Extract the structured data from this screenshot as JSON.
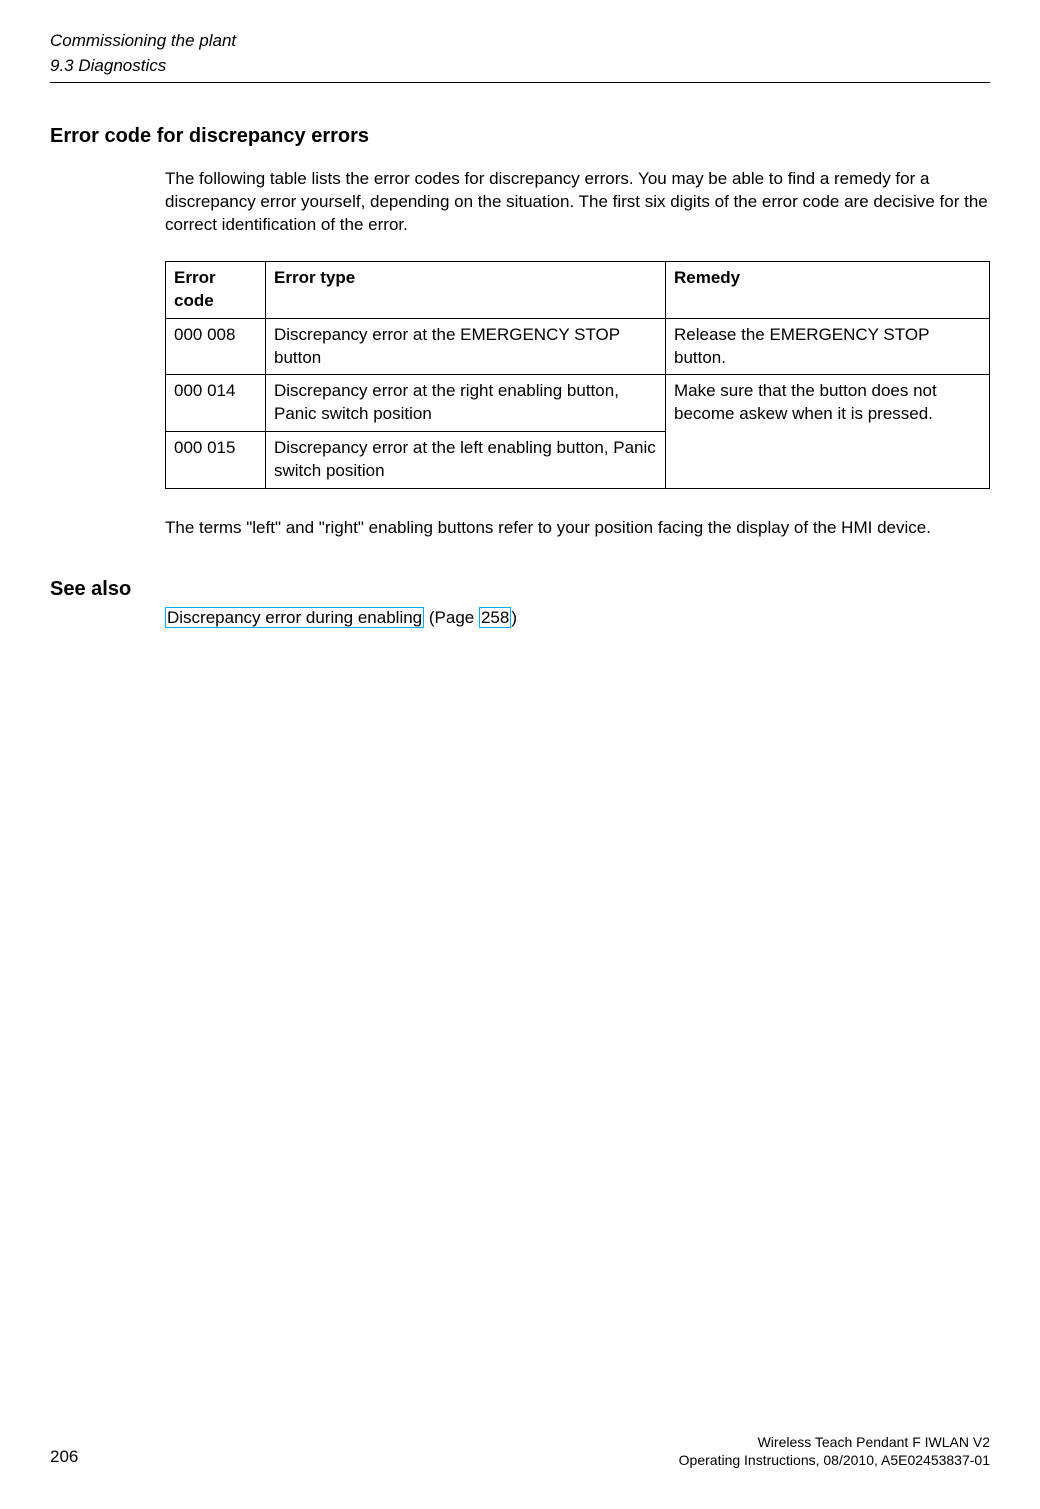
{
  "header": {
    "chapter": "Commissioning the plant",
    "section": "9.3 Diagnostics"
  },
  "heading1": "Error code for discrepancy errors",
  "intro": "The following table lists the error codes for discrepancy errors. You may be able to find a remedy for a discrepancy error yourself, depending on the situation. The first six digits of the error code are decisive for the correct identification of the error.",
  "table": {
    "head": {
      "code": "Error code",
      "type": "Error type",
      "remedy": "Remedy"
    },
    "rows": [
      {
        "code": "000 008",
        "type": "Discrepancy error at the EMERGENCY STOP button",
        "remedy": "Release the EMERGENCY STOP button."
      },
      {
        "code": "000 014",
        "type": "Discrepancy error at the right enabling button, Panic switch position",
        "remedy": "Make sure that the button does not become askew when it is pressed."
      },
      {
        "code": "000 015",
        "type": "Discrepancy error at the left enabling button, Panic switch position"
      }
    ]
  },
  "note": "The terms \"left\" and \"right\" enabling buttons refer to your position facing the display of the HMI device.",
  "seeAlso": {
    "heading": "See also",
    "linkText": "Discrepancy error during enabling",
    "pagePrefix": " (Page ",
    "pageNum": "258",
    "pageSuffix": ")"
  },
  "footer": {
    "line1": "Wireless Teach Pendant F IWLAN V2",
    "line2": "Operating Instructions, 08/2010, A5E02453837-01",
    "pageNumber": "206"
  }
}
